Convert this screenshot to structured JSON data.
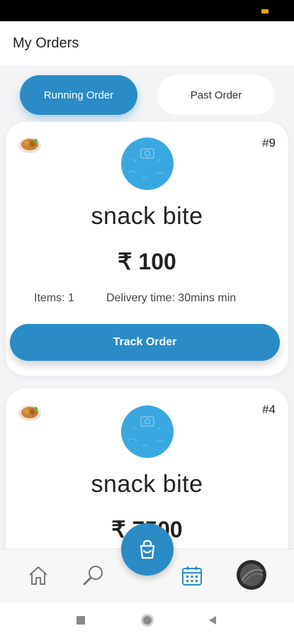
{
  "app": {
    "title": "My Orders"
  },
  "tabs": [
    {
      "label": "Running Order",
      "active": true
    },
    {
      "label": "Past Order",
      "active": false
    }
  ],
  "orders": [
    {
      "order_id": "#9",
      "restaurant": "snack bite",
      "price": "₹ 100",
      "items": "Items: 1",
      "delivery_time": "Delivery time: 30mins min",
      "action_label": "Track Order"
    },
    {
      "order_id": "#4",
      "restaurant": "snack bite",
      "price": "₹ 7500"
    }
  ],
  "nav": {
    "items": [
      {
        "name": "home",
        "icon": "home-icon"
      },
      {
        "name": "search",
        "icon": "search-icon"
      },
      {
        "name": "orders",
        "icon": "calendar-icon",
        "active": true
      },
      {
        "name": "profile",
        "icon": "avatar"
      }
    ],
    "fab_icon": "shopping-bag-icon"
  },
  "colors": {
    "accent": "#2a8bc7",
    "avatar_bg": "#3aa8e0"
  }
}
